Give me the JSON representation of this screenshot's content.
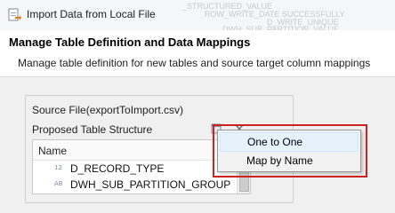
{
  "window": {
    "title": "Import Data from Local File",
    "icon": "import-file-icon",
    "ghost_text": [
      "_STRUCTURED_VALUE",
      "ROW_WRITE_DATE SUCCESSFULLY",
      "D_WRITE_UNIQUE",
      "DWH_SUB_PARTITION_VALUE"
    ]
  },
  "header": {
    "title": "Manage Table Definition and Data Mappings",
    "description": "Manage table definition for new tables and source target column mappings"
  },
  "source": {
    "label": "Source File(exportToImport.csv)"
  },
  "structure": {
    "label": "Proposed Table Structure",
    "toolbar_icons": [
      "table-structure-icon",
      "close-icon"
    ]
  },
  "table": {
    "column_header": "Name",
    "rows": [
      {
        "type_badge": "12",
        "name": "D_RECORD_TYPE"
      },
      {
        "type_badge": "AB",
        "name": "DWH_SUB_PARTITION_GROUP"
      }
    ]
  },
  "context_menu": {
    "items": [
      {
        "label": "One to One",
        "active": true
      },
      {
        "label": "Map by Name",
        "active": false
      }
    ],
    "highlight_color": "#d02020"
  }
}
